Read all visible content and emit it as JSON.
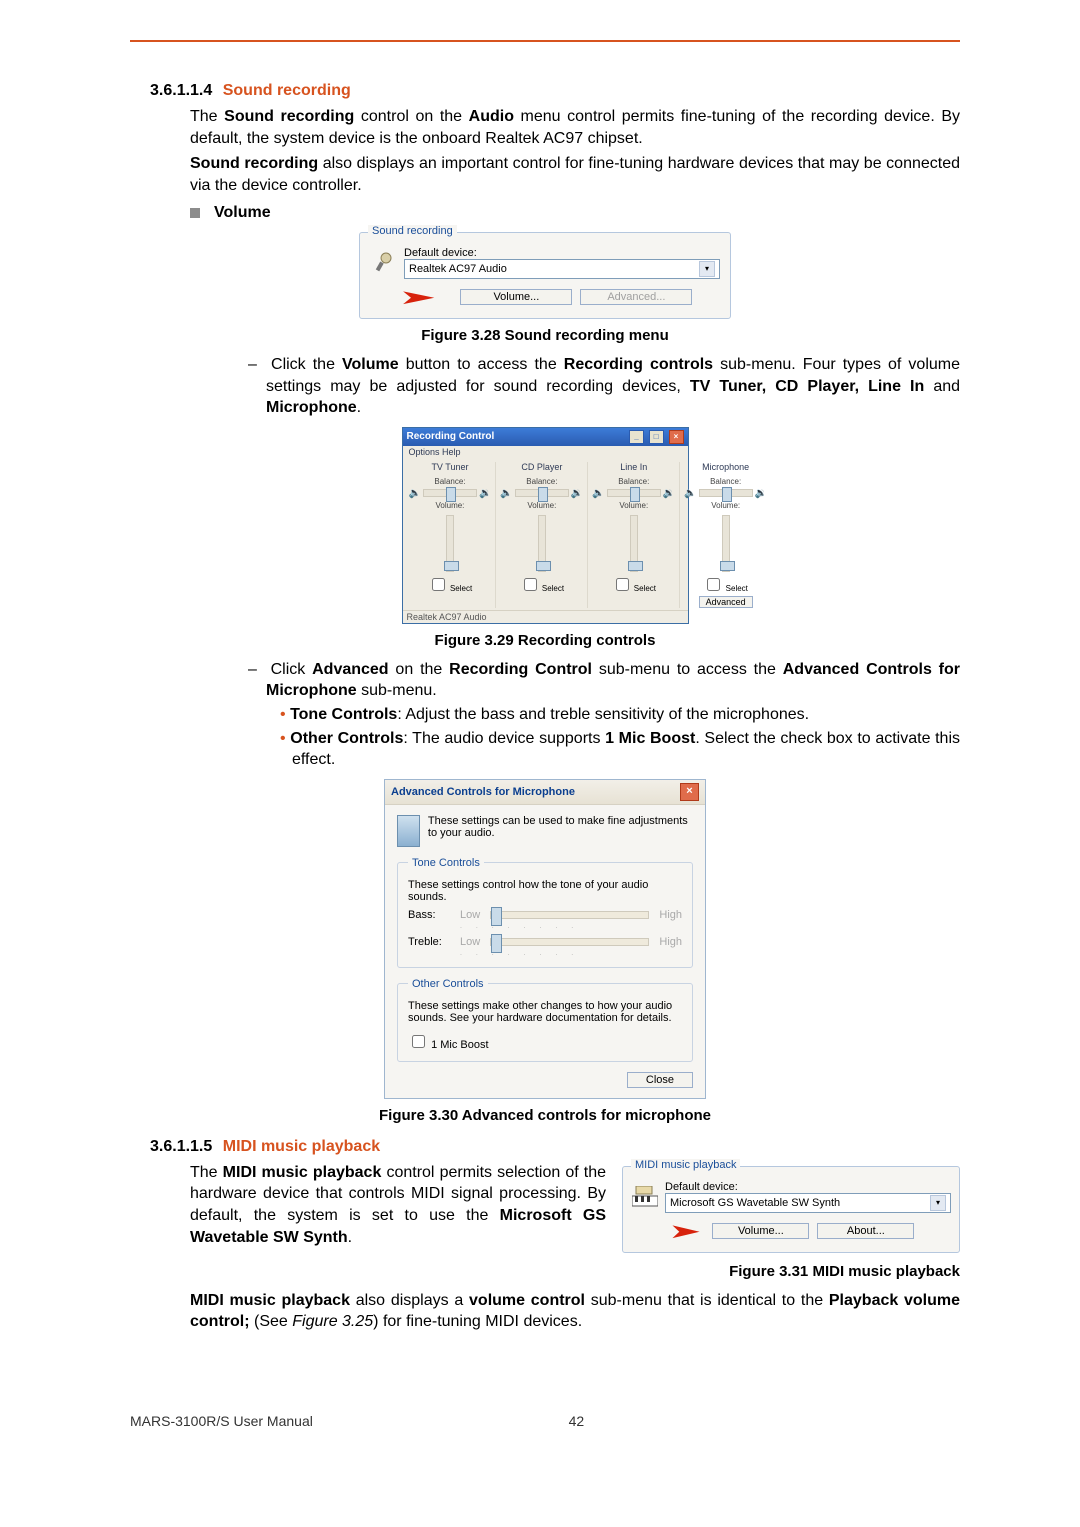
{
  "sec1": {
    "num": "3.6.1.1.4",
    "title": "Sound recording",
    "p1_a": "The ",
    "p1_b1": "Sound recording",
    "p1_c": " control on the ",
    "p1_b2": "Audio",
    "p1_d": " menu control permits fine-tuning of the recording device. By default, the system device is the onboard Realtek AC97 chipset.",
    "p2_b": "Sound recording",
    "p2_rest": " also displays an important control for fine-tuning hardware devices that may be connected via the device controller.",
    "volume_label": "Volume"
  },
  "fig28": {
    "caption": "Figure 3.28 Sound recording menu",
    "legend": "Sound recording",
    "default_device": "Default device:",
    "device_value": "Realtek AC97 Audio",
    "btn_volume": "Volume...",
    "btn_advanced": "Advanced..."
  },
  "bullet1": {
    "a": "Click the ",
    "b1": "Volume",
    "c": " button to access the ",
    "b2": "Recording controls",
    "d": " sub-menu. Four types of volume settings may be adjusted for sound recording devices, ",
    "b3": "TV Tuner, CD Player, Line In",
    "e": " and ",
    "b4": "Microphone",
    "f": "."
  },
  "fig29": {
    "caption": "Figure 3.29 Recording controls",
    "title": "Recording Control",
    "menu": "Options   Help",
    "cols": [
      "TV Tuner",
      "CD Player",
      "Line In",
      "Microphone"
    ],
    "balance": "Balance:",
    "volume": "Volume:",
    "select": "Select",
    "advanced": "Advanced",
    "status": "Realtek AC97 Audio"
  },
  "bullet2": {
    "a": "Click ",
    "b1": "Advanced",
    "c": " on the ",
    "b2": "Recording Control",
    "d": " sub-menu to access the ",
    "b3": "Advanced Controls for Microphone",
    "e": " sub-menu."
  },
  "sub1": {
    "b": "Tone Controls",
    "rest": ": Adjust the bass and treble sensitivity of the microphones."
  },
  "sub2": {
    "b": "Other Controls",
    "mid": ": The audio device supports ",
    "b2": "1 Mic Boost",
    "rest": ". Select the check box to activate this effect."
  },
  "fig30": {
    "caption": "Figure 3.30 Advanced controls for microphone",
    "title": "Advanced Controls for Microphone",
    "intro": "These settings can be used to make fine adjustments to your audio.",
    "tone_legend": "Tone Controls",
    "tone_desc": "These settings control how the tone of your audio sounds.",
    "bass": "Bass:",
    "treble": "Treble:",
    "low": "Low",
    "high": "High",
    "other_legend": "Other Controls",
    "other_desc": "These settings make other changes to how your audio sounds.  See your hardware documentation for details.",
    "mic_boost": "1  Mic Boost",
    "close": "Close"
  },
  "sec2": {
    "num": "3.6.1.1.5",
    "title": "MIDI music playback",
    "p1_a": "The ",
    "p1_b": "MIDI music playback",
    "p1_c": " control permits selection of the hardware device that controls MIDI signal processing. By default, the system is set to use the ",
    "p1_b2": "Microsoft GS Wavetable SW Synth",
    "p1_d": "."
  },
  "fig31": {
    "caption": "Figure 3.31 MIDI music playback",
    "legend": "MIDI music playback",
    "default_device": "Default device:",
    "device_value": "Microsoft GS Wavetable SW Synth",
    "btn_volume": "Volume...",
    "btn_about": "About..."
  },
  "para_last": {
    "b1": "MIDI music playback",
    "a": " also displays a ",
    "b2": "volume control",
    "c": " sub-menu that is identical to the ",
    "b3": "Playback volume control;",
    "d": " (See ",
    "i": "Figure 3.25",
    "e": ") for fine-tuning MIDI devices."
  },
  "footer": {
    "left": "MARS-3100R/S User Manual",
    "page": "42"
  }
}
